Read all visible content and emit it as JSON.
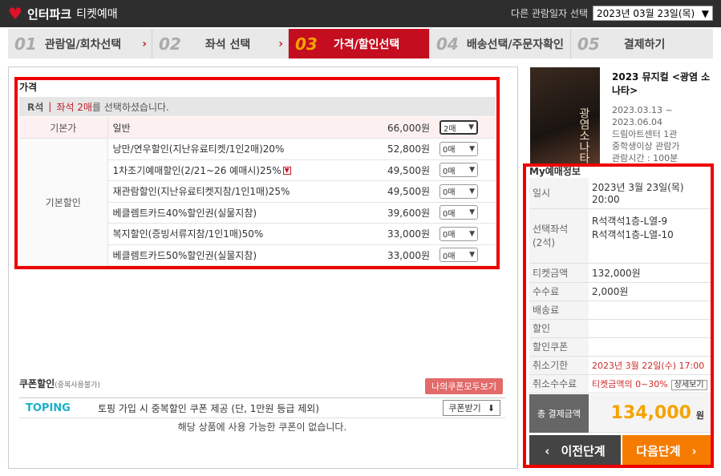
{
  "header": {
    "brand": "인터파크",
    "sub": "티켓예매",
    "date_label": "다른 관람일자 선택",
    "date_value": "2023년 03월 23일(목)"
  },
  "steps": [
    {
      "num": "01",
      "label": "관람일/회차선택"
    },
    {
      "num": "02",
      "label": "좌석 선택"
    },
    {
      "num": "03",
      "label": "가격/할인선택"
    },
    {
      "num": "04",
      "label": "배송선택/주문자확인"
    },
    {
      "num": "05",
      "label": "결제하기"
    }
  ],
  "price": {
    "title": "가격",
    "grade": "R석",
    "selected_prefix": "좌석 2매",
    "selected_suffix": "를 선택하셨습니다.",
    "base_category": "기본가",
    "discount_category": "기본할인",
    "rows": [
      {
        "name": "일반",
        "amount": "66,000원",
        "qty": "2매"
      },
      {
        "name": "낭만/연우할인(지난유료티켓/1인2매)20%",
        "amount": "52,800원",
        "qty": "0매"
      },
      {
        "name": "1차조기예매할인(2/21~26 예매시)25%",
        "amount": "49,500원",
        "qty": "0매"
      },
      {
        "name": "재관람할인(지난유료티켓지참/1인1매)25%",
        "amount": "49,500원",
        "qty": "0매"
      },
      {
        "name": "베클렘트카드40%할인권(실물지참)",
        "amount": "39,600원",
        "qty": "0매"
      },
      {
        "name": "복지할인(증빙서류지참/1인1매)50%",
        "amount": "33,000원",
        "qty": "0매"
      },
      {
        "name": "베클렘트카드50%할인권(실물지참)",
        "amount": "33,000원",
        "qty": "0매"
      }
    ]
  },
  "coupon": {
    "title": "쿠폰할인",
    "note": "(중복사용불가)",
    "all_button": "나의쿠폰모두보기",
    "provider": "TOPING",
    "text": "토핑 가입 시 중복할인 쿠폰 제공 (단, 1만원 등급 제외)",
    "get_button": "쿠폰받기",
    "empty": "해당 상품에 사용 가능한 쿠폰이 없습니다."
  },
  "show": {
    "title": "2023 뮤지컬 <광염 소나타>",
    "period": "2023.03.13 ~",
    "period_end": "2023.06.04",
    "venue": "드림아트센터 1관",
    "age": "중학생이상 관람가",
    "runtime": "관람시간 : 100분",
    "poster_text": "광염소나타"
  },
  "my": {
    "title": "My예매정보",
    "date_label": "일시",
    "date_value": "2023년 3월 23일(목) 20:00",
    "seat_label": "선택좌석\n(2석)",
    "seat1": "R석객석1층-L열-9",
    "seat2": "R석객석1층-L열-10",
    "ticket_label": "티켓금액",
    "ticket_value": "132,000원",
    "fee_label": "수수료",
    "fee_value": "2,000원",
    "delivery_label": "배송료",
    "discount_label": "할인",
    "coupon_label": "할인쿠폰",
    "cancel_deadline_label": "취소기한",
    "cancel_deadline_value": "2023년 3월 22일(수) 17:00",
    "cancel_fee_label": "취소수수료",
    "cancel_fee_value": "티켓금액의 0~30%",
    "detail_button": "상세보기",
    "total_label": "총 결제금액",
    "total_value": "134,000",
    "total_unit": "원",
    "prev": "이전단계",
    "next": "다음단계"
  }
}
